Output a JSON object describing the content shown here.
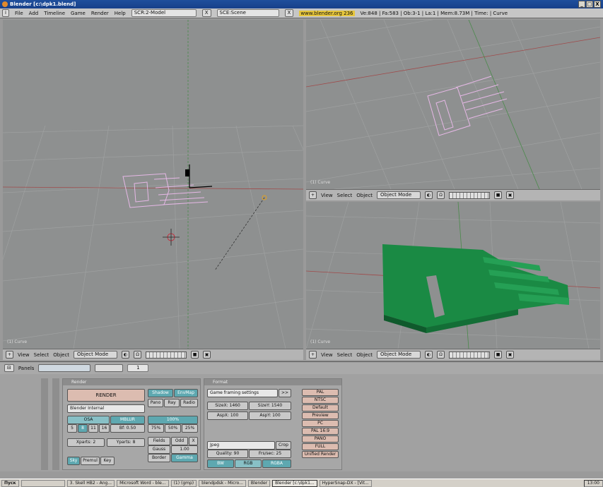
{
  "window": {
    "title": "Blender [c:\\dpk1.blend]",
    "controls": [
      "_",
      "□",
      "X"
    ]
  },
  "info": {
    "menus": [
      "File",
      "Add",
      "Timeline",
      "Game",
      "Render",
      "Help"
    ],
    "screen": "SCR:2-Model",
    "scene": "SCE:Scene",
    "link": "www.blender.org 236",
    "stats": "Ve:848 | Fa:583 | Ob:3-1 | La:1 | Mem:8.73M | Time: | Curve"
  },
  "viewport_header": {
    "menus": [
      "View",
      "Select",
      "Object"
    ],
    "mode": "Object Mode"
  },
  "viewports": {
    "label": "(1) Curve"
  },
  "buttons_header": {
    "menu": "Panels",
    "frame": "1"
  },
  "render_panel": {
    "title": "Render",
    "render_btn": "RENDER",
    "shadow": "Shadow",
    "envmap": "EnvMap",
    "pano": "Pano",
    "ray": "Ray",
    "radio": "Radio",
    "renderer": "Blender Internal",
    "osa": "OSA",
    "mblur": "MBLUR",
    "percent100": "100%",
    "osa_values": [
      "5",
      "8",
      "11",
      "16"
    ],
    "bf": "Bf: 0.50",
    "percents": [
      "75%",
      "50%",
      "25%"
    ],
    "xparts": "Xparts: 2",
    "yparts": "Yparts: 8",
    "fields": "Fields",
    "odd": "Odd",
    "x": "X",
    "gauss": "Gauss",
    "gauss_val": "1.00",
    "border": "Border",
    "gamma": "Gamma",
    "sky": "Sky",
    "premul": "Premul",
    "key": "Key"
  },
  "format_panel": {
    "title": "Format",
    "preset": "Game framing settings",
    "preset_btn": ">>",
    "sizex": "SizeX: 1460",
    "sizey": "SizeY: 1540",
    "aspx": "AspX: 100",
    "aspy": "AspY: 100",
    "format": "Jpeg",
    "crop": "Crop",
    "quality": "Quality: 90",
    "frs": "Frs/sec: 25",
    "bw": "BW",
    "rgb": "RGB",
    "rgba": "RGBA"
  },
  "presets": [
    "PAL",
    "NTSC",
    "Default",
    "Preview",
    "PC",
    "PAL 16:9",
    "PANO",
    "FULL",
    "Unified Render"
  ],
  "taskbar": {
    "start": "Пуск",
    "tasks": [
      "3. Skell HB2 - Ang...",
      "Microsoft Word - ble...",
      "(1) (gmp)",
      "blendpdsk - Micro...",
      "Blender",
      "Blender [c:\\dpk1...",
      "HyperSnap-DX - [Vit..."
    ],
    "active_index": 5,
    "clock": "13:00"
  },
  "colors": {
    "viewport_bg": "#8e9090",
    "grid": "#9c9e9e",
    "mesh_pink": "#e6b8e6",
    "mesh_green": "#1a8a44",
    "title_blue": "#1f4f9c"
  }
}
